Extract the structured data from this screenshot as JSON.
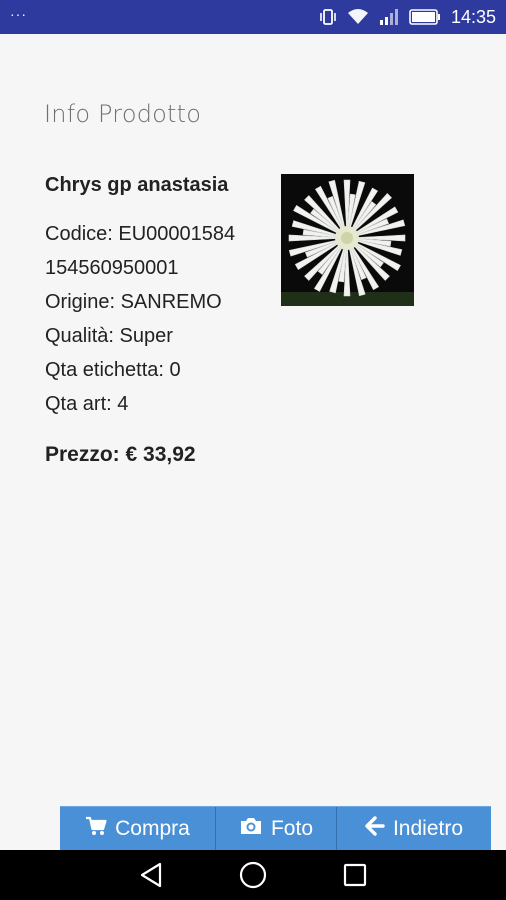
{
  "status_bar": {
    "menu_dots": "···",
    "time": "14:35"
  },
  "page": {
    "title": "Info Prodotto"
  },
  "product": {
    "name": "Chrys gp anastasia",
    "codice": "Codice: EU00001584",
    "barcode": "154560950001",
    "origine": "Origine: SANREMO",
    "qualita": "Qualità: Super",
    "qta_etichetta": "Qta etichetta: 0",
    "qta_art": "Qta art: 4",
    "prezzo": "Prezzo: € 33,92"
  },
  "actions": {
    "compra": "Compra",
    "foto": "Foto",
    "indietro": "Indietro"
  },
  "icons": {
    "status": [
      "vibrate-icon",
      "wifi-icon",
      "signal-icon",
      "battery-icon"
    ],
    "actions": [
      "cart-icon",
      "camera-icon",
      "arrow-left-icon"
    ],
    "nav": [
      "back-triangle-icon",
      "home-circle-icon",
      "recents-square-icon"
    ]
  },
  "colors": {
    "status_bar": "#2f3a9e",
    "action_bar": "#4a90d6",
    "background": "#f6f6f7"
  }
}
